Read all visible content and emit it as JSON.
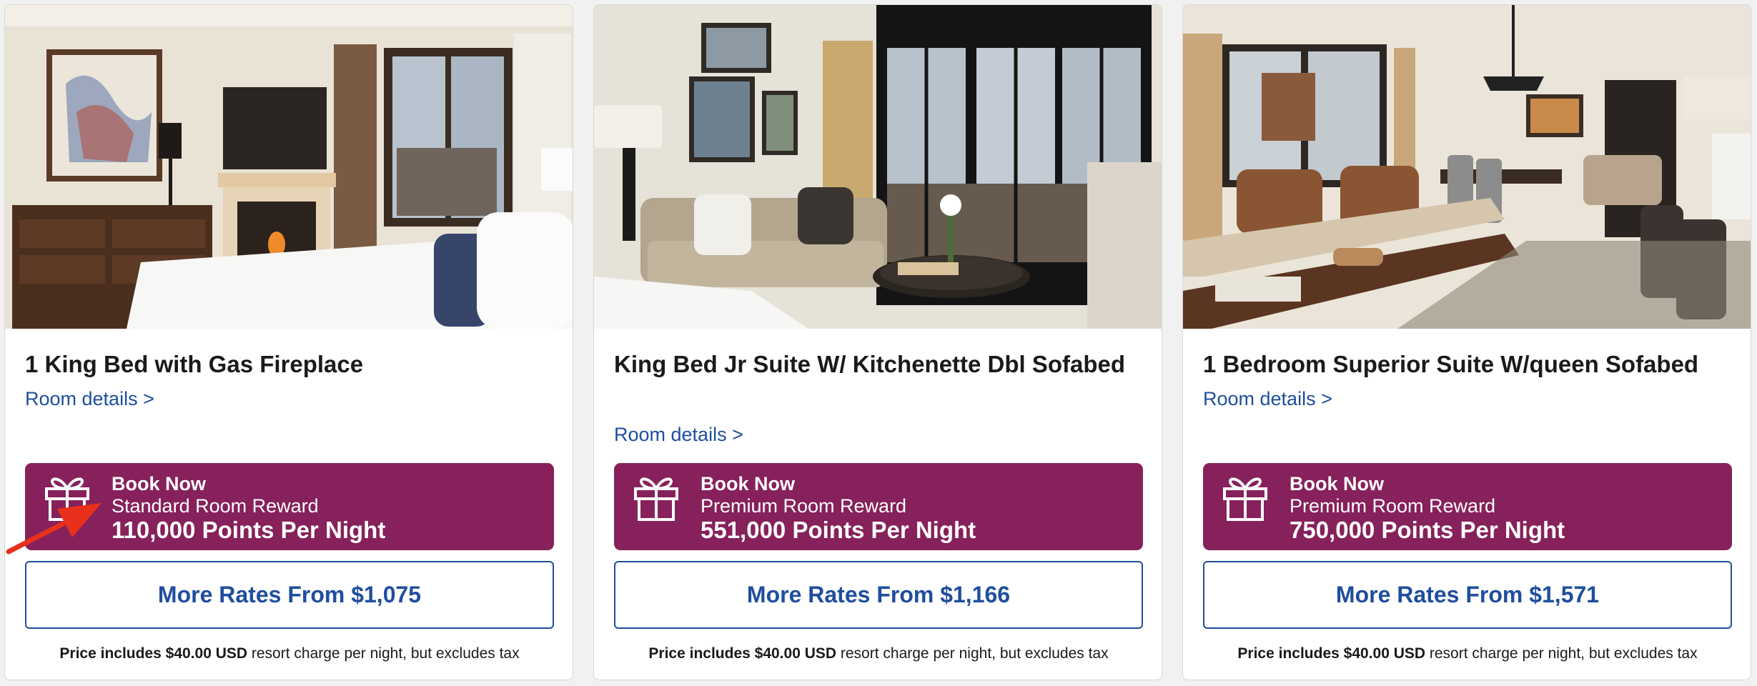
{
  "cards": [
    {
      "title": "1 King Bed with Gas Fireplace",
      "details_link": "Room details >",
      "reward": {
        "book_label": "Book Now",
        "type": "Standard Room Reward",
        "points": "110,000 Points Per Night"
      },
      "more_rates": "More Rates From $1,075",
      "price_note": {
        "bold": "Price includes $40.00 USD",
        "rest": " resort charge per night, but excludes tax"
      }
    },
    {
      "title": "King Bed Jr Suite W/ Kitchenette Dbl Sofabed",
      "details_link": "Room details >",
      "reward": {
        "book_label": "Book Now",
        "type": "Premium Room Reward",
        "points": "551,000 Points Per Night"
      },
      "more_rates": "More Rates From $1,166",
      "price_note": {
        "bold": "Price includes $40.00 USD",
        "rest": " resort charge per night, but excludes tax"
      }
    },
    {
      "title": "1 Bedroom Superior Suite W/queen Sofabed",
      "details_link": "Room details >",
      "reward": {
        "book_label": "Book Now",
        "type": "Premium Room Reward",
        "points": "750,000 Points Per Night"
      },
      "more_rates": "More Rates From $1,571",
      "price_note": {
        "bold": "Price includes $40.00 USD",
        "rest": " resort charge per night, but excludes tax"
      }
    }
  ],
  "colors": {
    "reward_bg": "#86215b",
    "link_blue": "#1f4e9e",
    "annotation_arrow": "#e8301c"
  },
  "icons": {
    "reward": "gift-icon"
  }
}
